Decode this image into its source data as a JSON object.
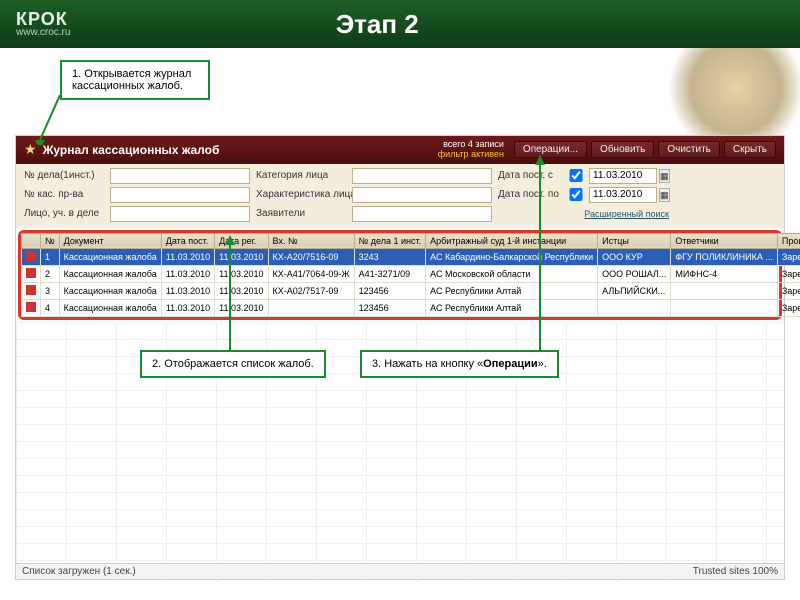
{
  "slide": {
    "title": "Этап 2",
    "logo": "КРОК",
    "logo_sub": "www.croc.ru"
  },
  "callouts": {
    "c1": "1. Открывается журнал кассационных жалоб.",
    "c2": "2. Отображается список жалоб.",
    "c3_pre": "3. Нажать на кнопку «",
    "c3_bold": "Операции",
    "c3_post": "»."
  },
  "app": {
    "title": "Журнал кассационных жалоб",
    "meta_line1": "всего 4 записи",
    "meta_line2": "фильтр активен",
    "buttons": {
      "ops": "Операции...",
      "refresh": "Обновить",
      "clear": "Очистить",
      "hide": "Скрыть"
    }
  },
  "filters": {
    "f1_label": "№ дела(1инст.)",
    "f2_label": "№ кас. пр-ва",
    "f3_label": "Лицо, уч. в деле",
    "f4_label": "Категория лица",
    "f5_label": "Характеристика лица",
    "f6_label": "Заявители",
    "d1_label": "Дата пост. с",
    "d2_label": "Дата пост. по",
    "d1_value": "11.03.2010",
    "d2_value": "11.03.2010",
    "adv": "Расширенный поиск"
  },
  "columns": [
    "№",
    "Документ",
    "Дата пост.",
    "Дата рег.",
    "Вх. №",
    "№ дела 1 инст.",
    "Арбитражный суд 1-й инстанции",
    "Истцы",
    "Ответчики",
    "Процессуальное состоя..."
  ],
  "rows": [
    {
      "n": "1",
      "doc": "Кассационная жалоба",
      "dp": "11.03.2010",
      "dr": "11.03.2010",
      "vh": "КХ-А20/7516-09",
      "nd": "3243",
      "court": "АС Кабардино-Балкарской Республики",
      "ist": "ООО КУР",
      "otv": "ФГУ ПОЛИКЛИНИКА ...",
      "proc": "Зарегистрировано",
      "sel": true
    },
    {
      "n": "2",
      "doc": "Кассационная жалоба",
      "dp": "11.03.2010",
      "dr": "11.03.2010",
      "vh": "КХ-А41/7064-09-Ж",
      "nd": "А41-3271/09",
      "court": "АС Московской области",
      "ist": "ООО РОШАЛ...",
      "otv": "МИФНС-4",
      "proc": "Зарегистрировано"
    },
    {
      "n": "3",
      "doc": "Кассационная жалоба",
      "dp": "11.03.2010",
      "dr": "11.03.2010",
      "vh": "КХ-А02/7517-09",
      "nd": "123456",
      "court": "АС Республики Алтай",
      "ist": "АЛЬПИЙСКИ...",
      "otv": "",
      "proc": "Зарегистрировано"
    },
    {
      "n": "4",
      "doc": "Кассационная жалоба",
      "dp": "11.03.2010",
      "dr": "11.03.2010",
      "vh": "",
      "nd": "123456",
      "court": "АС Республики Алтай",
      "ist": "",
      "otv": "",
      "proc": "Зарегистрировано"
    }
  ],
  "status": {
    "left": "Список загружен (1 сек.)",
    "right": "Trusted sites   100%"
  }
}
